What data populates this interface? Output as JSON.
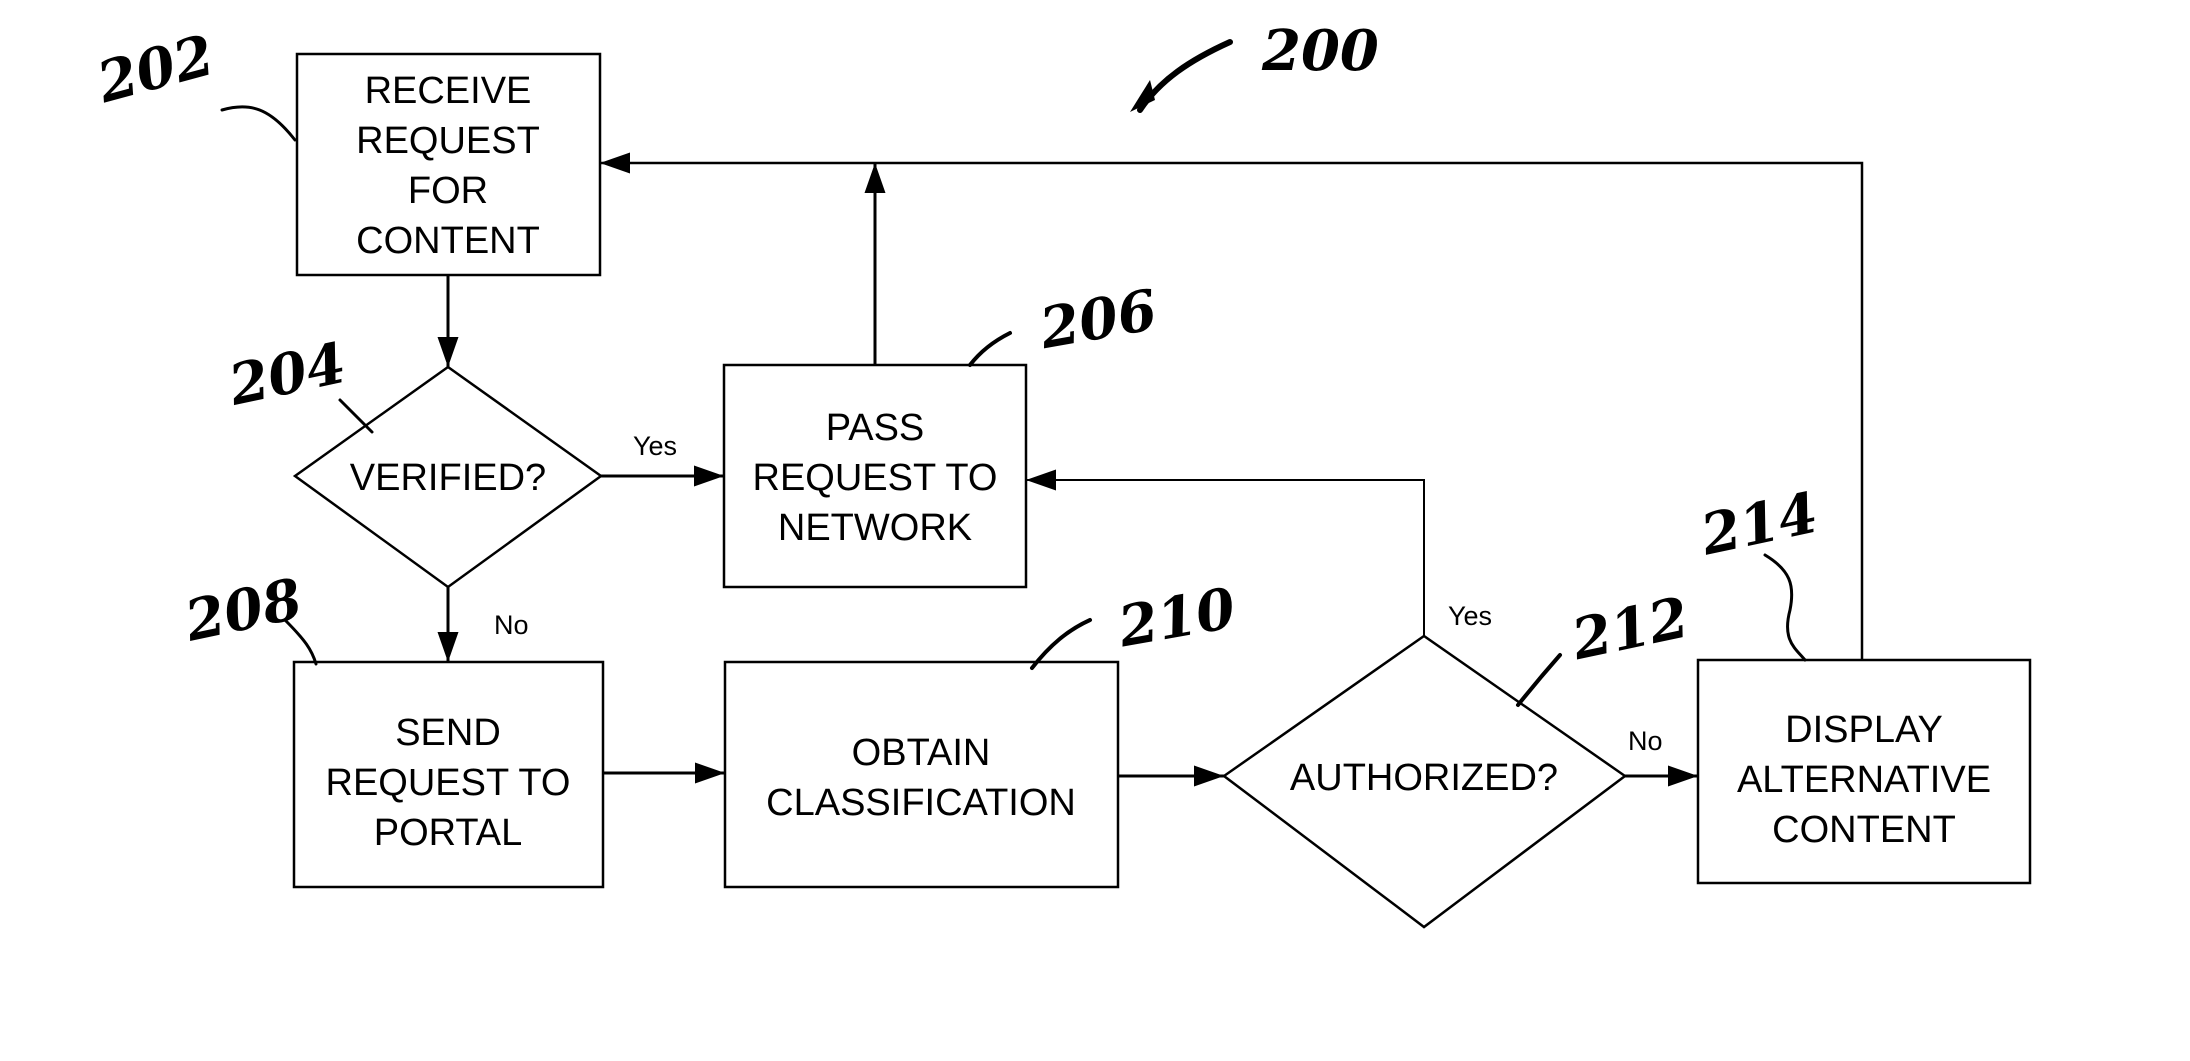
{
  "figure": {
    "reference": "200",
    "nodes": [
      {
        "id": "202",
        "type": "process",
        "lines": [
          "RECEIVE",
          "REQUEST",
          "FOR",
          "CONTENT"
        ]
      },
      {
        "id": "204",
        "type": "decision",
        "lines": [
          "VERIFIED?"
        ]
      },
      {
        "id": "206",
        "type": "process",
        "lines": [
          "PASS",
          "REQUEST TO",
          "NETWORK"
        ]
      },
      {
        "id": "208",
        "type": "process",
        "lines": [
          "SEND",
          "REQUEST TO",
          "PORTAL"
        ]
      },
      {
        "id": "210",
        "type": "process",
        "lines": [
          "OBTAIN",
          "CLASSIFICATION"
        ]
      },
      {
        "id": "212",
        "type": "decision",
        "lines": [
          "AUTHORIZED?"
        ]
      },
      {
        "id": "214",
        "type": "process",
        "lines": [
          "DISPLAY",
          "ALTERNATIVE",
          "CONTENT"
        ]
      }
    ],
    "edges": [
      {
        "from": "202",
        "to": "204",
        "label": ""
      },
      {
        "from": "204",
        "to": "206",
        "label": "Yes"
      },
      {
        "from": "204",
        "to": "208",
        "label": "No"
      },
      {
        "from": "206",
        "to": "202",
        "label": ""
      },
      {
        "from": "208",
        "to": "210",
        "label": ""
      },
      {
        "from": "210",
        "to": "212",
        "label": ""
      },
      {
        "from": "212",
        "to": "206",
        "label": "Yes"
      },
      {
        "from": "212",
        "to": "214",
        "label": "No"
      },
      {
        "from": "214",
        "to": "202",
        "label": ""
      }
    ]
  }
}
